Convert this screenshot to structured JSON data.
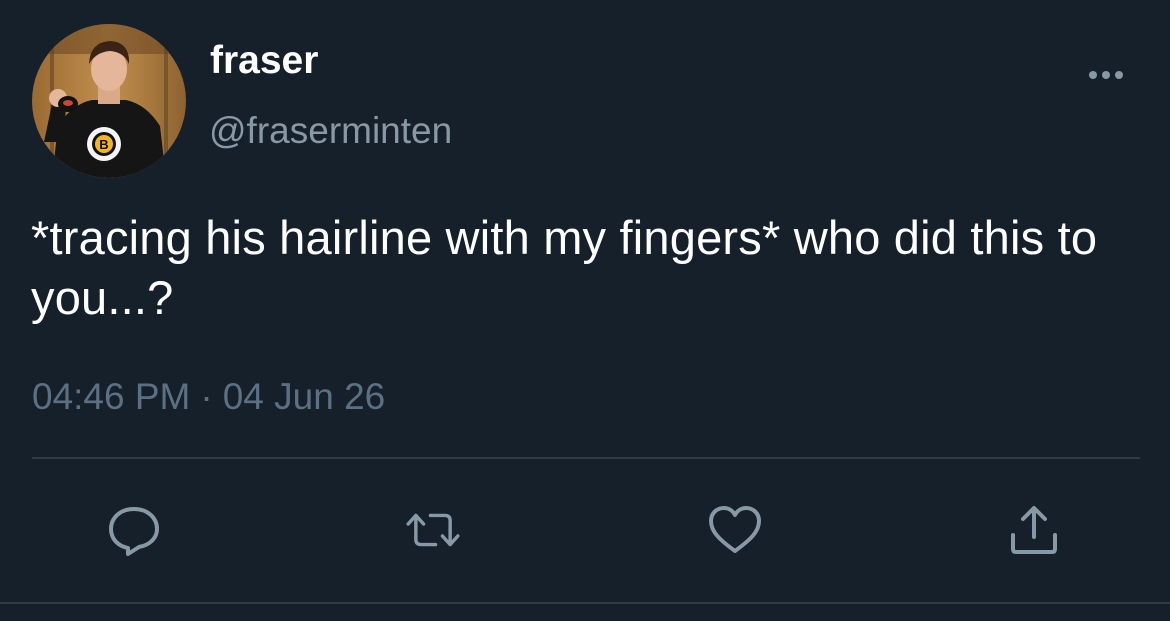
{
  "author": {
    "name": "fraser",
    "handle": "@fraserminten",
    "avatar_icon": "profile-photo"
  },
  "tweet": {
    "text": "*tracing his hairline with my fingers* who did this to you...?",
    "time": "04:46 PM",
    "separator": "·",
    "date": "04 Jun 26"
  },
  "actions": {
    "more_icon": "ellipsis-icon",
    "reply_icon": "speech-bubble-icon",
    "retweet_icon": "retweet-icon",
    "like_icon": "heart-icon",
    "share_icon": "share-upload-icon"
  },
  "colors": {
    "background": "#15202b",
    "primary_text": "#ffffff",
    "secondary_text": "#8899a6",
    "icon": "#8899a6",
    "divider": "#2f3b47"
  }
}
